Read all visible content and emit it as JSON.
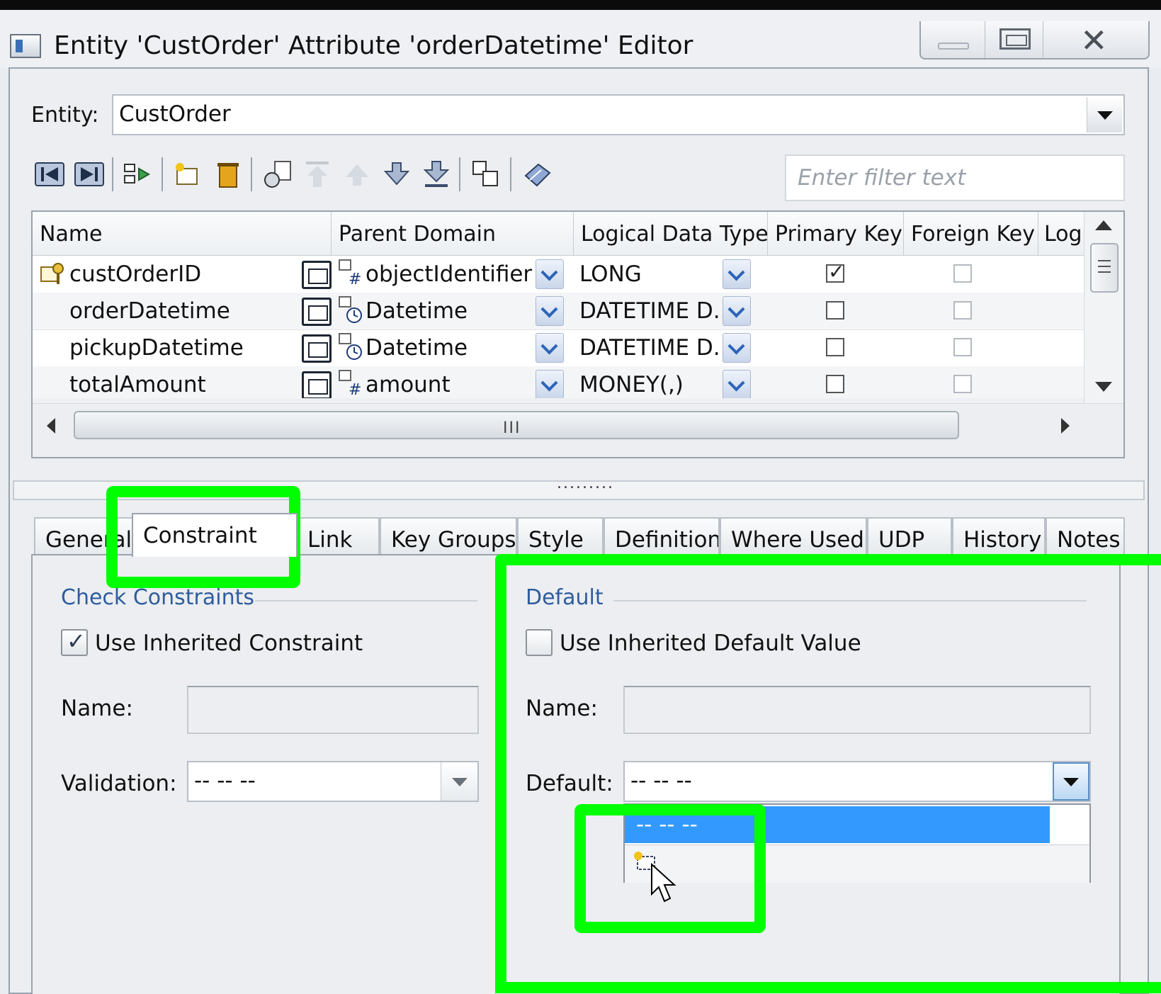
{
  "window": {
    "title": "Entity 'CustOrder' Attribute 'orderDatetime' Editor",
    "controls": {
      "minimize": "minimize",
      "maximize": "maximize",
      "close": "close"
    }
  },
  "entity": {
    "label": "Entity:",
    "value": "CustOrder"
  },
  "toolbar": {
    "icons": [
      "first-icon",
      "last-icon",
      "move-icon",
      "new-attribute-icon",
      "delete-icon",
      "reorder-icon",
      "move-top-icon",
      "move-up-icon",
      "move-down-icon",
      "move-bottom-icon",
      "copy-icon",
      "eraser-icon"
    ]
  },
  "filter": {
    "placeholder": "Enter filter text"
  },
  "grid": {
    "columns": [
      "Name",
      "Parent Domain",
      "Logical Data Type",
      "Primary Key",
      "Foreign Key",
      "Log"
    ],
    "rows": [
      {
        "name": "custOrderID",
        "domain": "objectIdentifier",
        "domain_icon": "hash-icon",
        "type": "LONG",
        "pk": true,
        "fk": false,
        "key_icon": true
      },
      {
        "name": "orderDatetime",
        "domain": "Datetime",
        "domain_icon": "clock-icon",
        "type": "DATETIME D...",
        "pk": false,
        "fk": false,
        "key_icon": false
      },
      {
        "name": "pickupDatetime",
        "domain": "Datetime",
        "domain_icon": "clock-icon",
        "type": "DATETIME D...",
        "pk": false,
        "fk": false,
        "key_icon": false
      },
      {
        "name": "totalAmount",
        "domain": "amount",
        "domain_icon": "hash-icon",
        "type": "MONEY(,)",
        "pk": false,
        "fk": false,
        "key_icon": false
      }
    ],
    "hscroll_grip": "III"
  },
  "splitter": {
    "grip": "........."
  },
  "tabs": [
    {
      "label": "General",
      "active": false
    },
    {
      "label": "Constraint",
      "active": true
    },
    {
      "label": "Link",
      "active": false
    },
    {
      "label": "Key Groups",
      "active": false
    },
    {
      "label": "Style",
      "active": false
    },
    {
      "label": "Definition",
      "active": false
    },
    {
      "label": "Where Used",
      "active": false
    },
    {
      "label": "UDP",
      "active": false
    },
    {
      "label": "History",
      "active": false
    },
    {
      "label": "Notes",
      "active": false
    }
  ],
  "check_constraints": {
    "title": "Check Constraints",
    "use_inherited_label": "Use Inherited Constraint",
    "use_inherited_checked": true,
    "name_label": "Name:",
    "name_value": "",
    "validation_label": "Validation:",
    "validation_value": "-- -- --"
  },
  "default_group": {
    "title": "Default",
    "use_inherited_label": "Use Inherited Default Value",
    "use_inherited_checked": false,
    "name_label": "Name:",
    "name_value": "",
    "default_label": "Default:",
    "default_value": "-- -- --",
    "dropdown_options": [
      "-- -- --",
      ""
    ]
  },
  "colors": {
    "highlight": "#00ff00",
    "selection": "#3399ff",
    "group_title": "#2f5d9e"
  }
}
